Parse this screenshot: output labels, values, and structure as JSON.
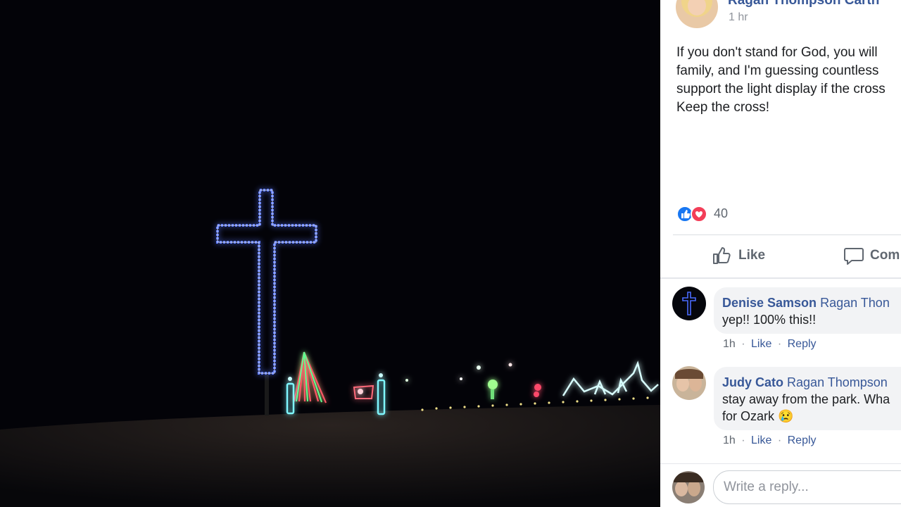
{
  "post": {
    "author": "Ragan Thompson Carth",
    "time": "1 hr",
    "text_lines": [
      "If you don't stand for God, you will",
      "family, and I'm guessing countless",
      "support the light display if the cross",
      "Keep the cross!"
    ],
    "reaction_count": "40",
    "reaction_icons": [
      "like-icon",
      "love-icon"
    ]
  },
  "actions": {
    "like_label": "Like",
    "comment_label": "Com"
  },
  "comments": [
    {
      "author": "Denise Samson",
      "mention": "Ragan Thon",
      "lines": [
        "yep!! 100% this!!"
      ],
      "time": "1h",
      "like_label": "Like",
      "reply_label": "Reply",
      "sep": "·"
    },
    {
      "author": "Judy Cato",
      "mention": "Ragan Thompson",
      "lines": [
        "stay away from the park. Wha",
        "for Ozark 😢"
      ],
      "time": "1h",
      "like_label": "Like",
      "reply_label": "Reply",
      "sep": "·"
    }
  ],
  "reply_box": {
    "placeholder": "Write a reply..."
  },
  "colors": {
    "link": "#385898",
    "cross_light": "#3b5bff",
    "like_blue": "#1877f2",
    "love_red": "#f33e58"
  }
}
